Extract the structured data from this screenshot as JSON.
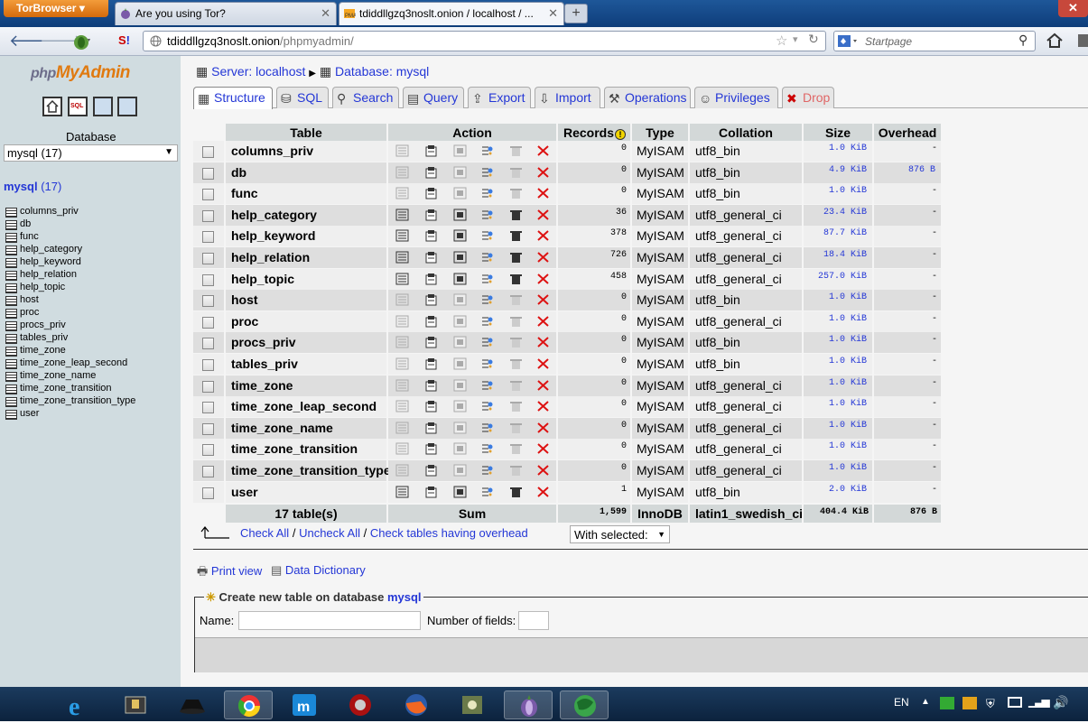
{
  "browser": {
    "menu_label": "TorBrowser",
    "tabs": [
      {
        "title": "Are you using Tor?"
      },
      {
        "title": "tdiddllgzq3noslt.onion / localhost / ..."
      }
    ],
    "url": "tdiddllgzq3noslt.onion/phpmyadmin/",
    "url_domain": "tdiddllgzq3noslt.onion",
    "url_path": "/phpmyadmin/",
    "search_placeholder": "Startpage"
  },
  "sidebar": {
    "logo": "phpMyAdmin",
    "database_label": "Database",
    "database_select": "mysql (17)",
    "db_link": "mysql",
    "db_count": "(17)",
    "tables": [
      "columns_priv",
      "db",
      "func",
      "help_category",
      "help_keyword",
      "help_relation",
      "help_topic",
      "host",
      "proc",
      "procs_priv",
      "tables_priv",
      "time_zone",
      "time_zone_leap_second",
      "time_zone_name",
      "time_zone_transition",
      "time_zone_transition_type",
      "user"
    ]
  },
  "breadcrumb": {
    "server_label": "Server: localhost",
    "database_label": "Database: mysql"
  },
  "nav_tabs": [
    "Structure",
    "SQL",
    "Search",
    "Query",
    "Export",
    "Import",
    "Operations",
    "Privileges",
    "Drop"
  ],
  "table": {
    "headers": {
      "table": "Table",
      "action": "Action",
      "records": "Records",
      "type": "Type",
      "collation": "Collation",
      "size": "Size",
      "overhead": "Overhead"
    },
    "rows": [
      {
        "name": "columns_priv",
        "records": "0",
        "type": "MyISAM",
        "collation": "utf8_bin",
        "size": "1.0 KiB",
        "overhead": "-",
        "filled": false
      },
      {
        "name": "db",
        "records": "0",
        "type": "MyISAM",
        "collation": "utf8_bin",
        "size": "4.9 KiB",
        "overhead": "876 B",
        "filled": false
      },
      {
        "name": "func",
        "records": "0",
        "type": "MyISAM",
        "collation": "utf8_bin",
        "size": "1.0 KiB",
        "overhead": "-",
        "filled": false
      },
      {
        "name": "help_category",
        "records": "36",
        "type": "MyISAM",
        "collation": "utf8_general_ci",
        "size": "23.4 KiB",
        "overhead": "-",
        "filled": true
      },
      {
        "name": "help_keyword",
        "records": "378",
        "type": "MyISAM",
        "collation": "utf8_general_ci",
        "size": "87.7 KiB",
        "overhead": "-",
        "filled": true
      },
      {
        "name": "help_relation",
        "records": "726",
        "type": "MyISAM",
        "collation": "utf8_general_ci",
        "size": "18.4 KiB",
        "overhead": "-",
        "filled": true
      },
      {
        "name": "help_topic",
        "records": "458",
        "type": "MyISAM",
        "collation": "utf8_general_ci",
        "size": "257.0 KiB",
        "overhead": "-",
        "filled": true
      },
      {
        "name": "host",
        "records": "0",
        "type": "MyISAM",
        "collation": "utf8_bin",
        "size": "1.0 KiB",
        "overhead": "-",
        "filled": false
      },
      {
        "name": "proc",
        "records": "0",
        "type": "MyISAM",
        "collation": "utf8_general_ci",
        "size": "1.0 KiB",
        "overhead": "-",
        "filled": false
      },
      {
        "name": "procs_priv",
        "records": "0",
        "type": "MyISAM",
        "collation": "utf8_bin",
        "size": "1.0 KiB",
        "overhead": "-",
        "filled": false
      },
      {
        "name": "tables_priv",
        "records": "0",
        "type": "MyISAM",
        "collation": "utf8_bin",
        "size": "1.0 KiB",
        "overhead": "-",
        "filled": false
      },
      {
        "name": "time_zone",
        "records": "0",
        "type": "MyISAM",
        "collation": "utf8_general_ci",
        "size": "1.0 KiB",
        "overhead": "-",
        "filled": false
      },
      {
        "name": "time_zone_leap_second",
        "records": "0",
        "type": "MyISAM",
        "collation": "utf8_general_ci",
        "size": "1.0 KiB",
        "overhead": "-",
        "filled": false
      },
      {
        "name": "time_zone_name",
        "records": "0",
        "type": "MyISAM",
        "collation": "utf8_general_ci",
        "size": "1.0 KiB",
        "overhead": "-",
        "filled": false
      },
      {
        "name": "time_zone_transition",
        "records": "0",
        "type": "MyISAM",
        "collation": "utf8_general_ci",
        "size": "1.0 KiB",
        "overhead": "-",
        "filled": false
      },
      {
        "name": "time_zone_transition_type",
        "records": "0",
        "type": "MyISAM",
        "collation": "utf8_general_ci",
        "size": "1.0 KiB",
        "overhead": "-",
        "filled": false
      },
      {
        "name": "user",
        "records": "1",
        "type": "MyISAM",
        "collation": "utf8_bin",
        "size": "2.0 KiB",
        "overhead": "-",
        "filled": true
      }
    ],
    "footer": {
      "tables": "17 table(s)",
      "sum": "Sum",
      "records": "1,599",
      "type": "InnoDB",
      "collation": "latin1_swedish_ci",
      "size": "404.4 KiB",
      "overhead": "876 B"
    }
  },
  "bulk": {
    "check_all": "Check All",
    "uncheck_all": "Uncheck All",
    "check_overhead": "Check tables having overhead",
    "sep": "/",
    "with_selected": "With selected:"
  },
  "links": {
    "print_view": "Print view",
    "data_dictionary": "Data Dictionary"
  },
  "create": {
    "legend_prefix": "Create new table on database",
    "legend_db": "mysql",
    "name_label": "Name:",
    "fields_label": "Number of fields:"
  },
  "taskbar": {
    "lang": "EN"
  },
  "colors": {
    "link": "#2437d6",
    "sidebar_bg": "#d0dce0",
    "header_bg": "#d3d8d8",
    "drop": "#e06666"
  }
}
